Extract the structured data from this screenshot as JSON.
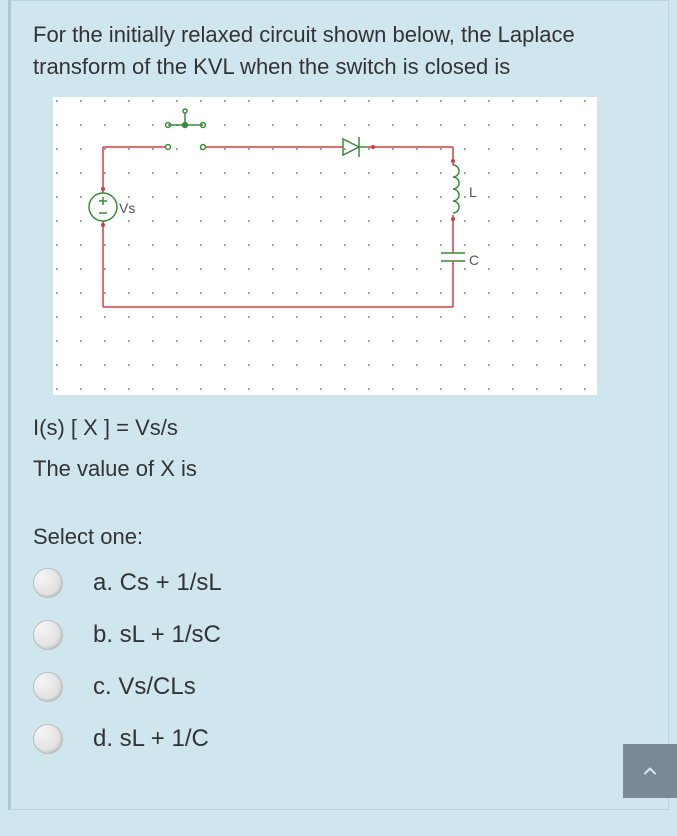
{
  "question": {
    "stem": "For the initially relaxed circuit shown below, the Laplace transform of the KVL when the switch is closed is",
    "equation_line1": "I(s) [ X ] = Vs/s",
    "equation_line2": "The value of X is"
  },
  "diagram": {
    "labels": {
      "source": "Vs",
      "inductor": "L",
      "capacitor": "C"
    }
  },
  "prompt": "Select one:",
  "options": [
    {
      "id": "a",
      "label": "a. Cs + 1/sL"
    },
    {
      "id": "b",
      "label": "b. sL + 1/sC"
    },
    {
      "id": "c",
      "label": "c. Vs/CLs"
    },
    {
      "id": "d",
      "label": "d. sL + 1/C"
    }
  ],
  "scroll_top_icon": "chevron-up"
}
